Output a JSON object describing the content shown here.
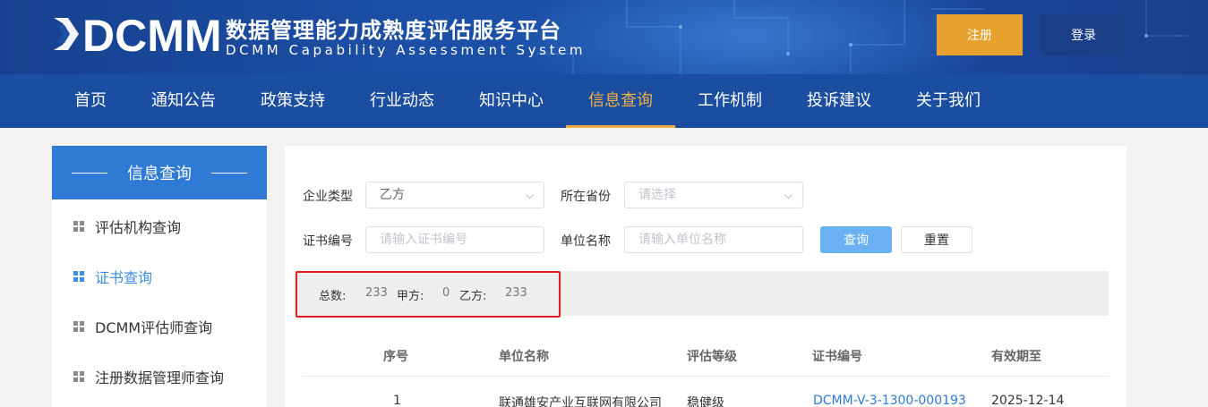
{
  "header": {
    "logo_text": "DCMM",
    "title_cn": "数据管理能力成熟度评估服务平台",
    "title_en": "DCMM Capability Assessment System",
    "register_label": "注册",
    "login_label": "登录"
  },
  "nav": {
    "items": [
      "首页",
      "通知公告",
      "政策支持",
      "行业动态",
      "知识中心",
      "信息查询",
      "工作机制",
      "投诉建议",
      "关于我们"
    ],
    "active": "信息查询"
  },
  "sidebar": {
    "title": "信息查询",
    "items": [
      "评估机构查询",
      "证书查询",
      "DCMM评估师查询",
      "注册数据管理师查询"
    ],
    "active": "证书查询"
  },
  "filters": {
    "company_type_label": "企业类型",
    "company_type_value": "乙方",
    "province_label": "所在省份",
    "province_placeholder": "请选择",
    "cert_no_label": "证书编号",
    "cert_no_placeholder": "请输入证书编号",
    "unit_name_label": "单位名称",
    "unit_name_placeholder": "请输入单位名称",
    "query_label": "查询",
    "reset_label": "重置"
  },
  "stats": {
    "total_label": "总数:",
    "total_value": "233",
    "party_a_label": "甲方:",
    "party_a_value": "0",
    "party_b_label": "乙方:",
    "party_b_value": "233"
  },
  "table": {
    "headers": [
      "序号",
      "单位名称",
      "评估等级",
      "证书编号",
      "有效期至"
    ],
    "rows": [
      {
        "index": "1",
        "unit": "联通雄安产业互联网有限公司",
        "level": "稳健级",
        "cert_no": "DCMM-V-3-1300-000193",
        "valid_until": "2025-12-14"
      }
    ]
  },
  "colors": {
    "header_blue": "#1b4ea0",
    "accent_orange": "#e7a12e",
    "active_nav": "#f0b040",
    "sidebar_head": "#2f7ad4",
    "highlight_red": "#e02020"
  }
}
